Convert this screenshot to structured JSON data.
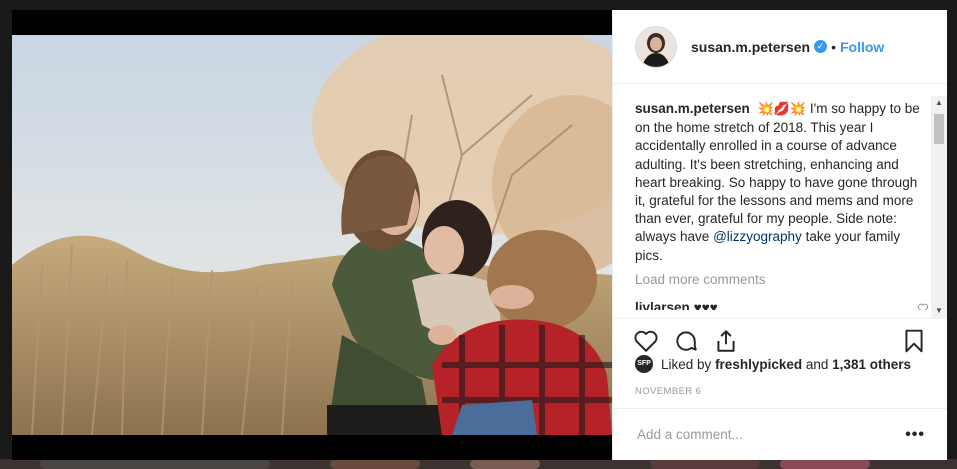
{
  "post": {
    "username": "susan.m.petersen",
    "verified_icon": "verified-badge-icon",
    "follow_dot": "•",
    "follow_label": "Follow",
    "caption": {
      "username": "susan.m.petersen",
      "emojis": "💥💋💥",
      "text_before_mention": "I'm so happy to be on the home stretch of 2018. This year I accidentally enrolled in a course of advance adulting. It's been stretching, enhancing and heart breaking. So happy to have gone through it, grateful for the lessons and mems and more than ever, grateful for my people. Side note: always have",
      "mention": "@lizzyography",
      "text_after_mention": "take your family pics."
    },
    "load_more_label": "Load more comments",
    "comments": [
      {
        "username": "livlarsen",
        "text": "♥♥♥"
      }
    ],
    "likes": {
      "avatar_text": "SFP",
      "prefix": "Liked by",
      "user": "freshlypicked",
      "connector": "and",
      "others": "1,381 others"
    },
    "date": "NOVEMBER 6",
    "add_comment_placeholder": "Add a comment...",
    "more_label": "•••"
  },
  "colors": {
    "accent": "#3897f0",
    "text": "#262626",
    "muted": "#999999",
    "mention": "#003569"
  }
}
